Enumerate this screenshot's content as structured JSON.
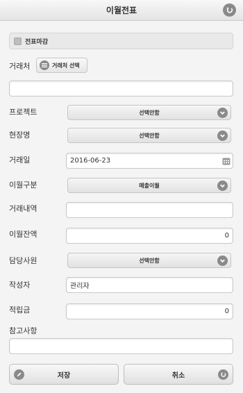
{
  "header": {
    "title": "이월전표"
  },
  "closing": {
    "label": "전표마감"
  },
  "vendor": {
    "label": "거래처",
    "button": "거래처 선택",
    "value": ""
  },
  "project": {
    "label": "프로젝트",
    "selected": "선택안함"
  },
  "site": {
    "label": "현장명",
    "selected": "선택안함"
  },
  "trade_date": {
    "label": "거래일",
    "value": "2016-06-23"
  },
  "carry_type": {
    "label": "이월구분",
    "selected": "매출이월"
  },
  "trade_detail": {
    "label": "거래내역",
    "value": ""
  },
  "carry_balance": {
    "label": "이월잔액",
    "value": "0"
  },
  "staff": {
    "label": "담당사원",
    "selected": "선택안함"
  },
  "author": {
    "label": "작성자",
    "value": "관리자"
  },
  "reserve": {
    "label": "적립금",
    "value": "0"
  },
  "remarks": {
    "label": "참고사항",
    "value": ""
  },
  "actions": {
    "save": "저장",
    "cancel": "취소"
  }
}
